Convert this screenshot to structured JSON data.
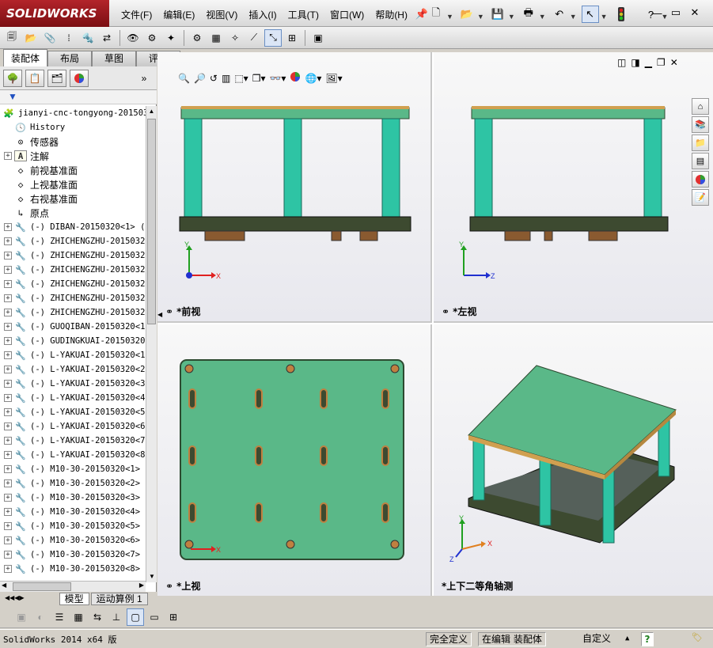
{
  "app": {
    "logo_text": "SOLIDWORKS",
    "menu": [
      "文件(F)",
      "编辑(E)",
      "视图(V)",
      "插入(I)",
      "工具(T)",
      "窗口(W)",
      "帮助(H)"
    ]
  },
  "tabs": [
    "装配体",
    "布局",
    "草图",
    "评估"
  ],
  "tree": {
    "root": "jianyi-cnc-tongyong-201503",
    "items": [
      {
        "label": "History",
        "icon": "history-icon",
        "expandable": false
      },
      {
        "label": "传感器",
        "icon": "sensor-icon",
        "expandable": false
      },
      {
        "label": "注解",
        "icon": "annotation-icon",
        "expandable": true
      },
      {
        "label": "前视基准面",
        "icon": "plane-icon",
        "expandable": false
      },
      {
        "label": "上视基准面",
        "icon": "plane-icon",
        "expandable": false
      },
      {
        "label": "右视基准面",
        "icon": "plane-icon",
        "expandable": false
      },
      {
        "label": "原点",
        "icon": "origin-icon",
        "expandable": false
      },
      {
        "label": "(-) DIBAN-20150320<1> (",
        "icon": "part-icon",
        "expandable": true
      },
      {
        "label": "(-) ZHICHENGZHU-2015032",
        "icon": "part-icon",
        "expandable": true
      },
      {
        "label": "(-) ZHICHENGZHU-2015032",
        "icon": "part-icon",
        "expandable": true
      },
      {
        "label": "(-) ZHICHENGZHU-2015032",
        "icon": "part-icon",
        "expandable": true
      },
      {
        "label": "(-) ZHICHENGZHU-2015032",
        "icon": "part-icon",
        "expandable": true
      },
      {
        "label": "(-) ZHICHENGZHU-2015032",
        "icon": "part-icon",
        "expandable": true
      },
      {
        "label": "(-) ZHICHENGZHU-2015032",
        "icon": "part-icon",
        "expandable": true
      },
      {
        "label": "(-) GUOQIBAN-20150320<1",
        "icon": "part-icon",
        "expandable": true
      },
      {
        "label": "(-) GUDINGKUAI-20150320",
        "icon": "part-icon",
        "expandable": true
      },
      {
        "label": "(-) L-YAKUAI-20150320<1",
        "icon": "part-icon",
        "expandable": true
      },
      {
        "label": "(-) L-YAKUAI-20150320<2",
        "icon": "part-icon",
        "expandable": true
      },
      {
        "label": "(-) L-YAKUAI-20150320<3",
        "icon": "part-icon",
        "expandable": true
      },
      {
        "label": "(-) L-YAKUAI-20150320<4",
        "icon": "part-icon",
        "expandable": true
      },
      {
        "label": "(-) L-YAKUAI-20150320<5",
        "icon": "part-icon",
        "expandable": true
      },
      {
        "label": "(-) L-YAKUAI-20150320<6",
        "icon": "part-icon",
        "expandable": true
      },
      {
        "label": "(-) L-YAKUAI-20150320<7",
        "icon": "part-icon",
        "expandable": true
      },
      {
        "label": "(-) L-YAKUAI-20150320<8",
        "icon": "part-icon",
        "expandable": true
      },
      {
        "label": "(-) M10-30-20150320<1>",
        "icon": "part-icon",
        "expandable": true
      },
      {
        "label": "(-) M10-30-20150320<2>",
        "icon": "part-icon",
        "expandable": true
      },
      {
        "label": "(-) M10-30-20150320<3>",
        "icon": "part-icon",
        "expandable": true
      },
      {
        "label": "(-) M10-30-20150320<4>",
        "icon": "part-icon",
        "expandable": true
      },
      {
        "label": "(-) M10-30-20150320<5>",
        "icon": "part-icon",
        "expandable": true
      },
      {
        "label": "(-) M10-30-20150320<6>",
        "icon": "part-icon",
        "expandable": true
      },
      {
        "label": "(-) M10-30-20150320<7>",
        "icon": "part-icon",
        "expandable": true
      },
      {
        "label": "(-) M10-30-20150320<8>",
        "icon": "part-icon",
        "expandable": true
      }
    ]
  },
  "bottom_tabs": [
    "模型",
    "运动算例 1"
  ],
  "viewports": {
    "front": "*前视",
    "left": "*左视",
    "top": "*上视",
    "iso": "*上下二等角轴测"
  },
  "axes": {
    "x": "X",
    "y": "Y",
    "z": "Z"
  },
  "status": {
    "app": "SolidWorks 2014 x64 版",
    "defined": "完全定义",
    "editing": "在编辑 装配体",
    "custom": "自定义",
    "help": "?"
  },
  "colors": {
    "plate": "#5ab888",
    "pillar": "#2ec4a4",
    "base": "#3d4a30",
    "axis_x": "#e02020",
    "axis_y": "#20a020",
    "axis_z": "#2030d0"
  }
}
